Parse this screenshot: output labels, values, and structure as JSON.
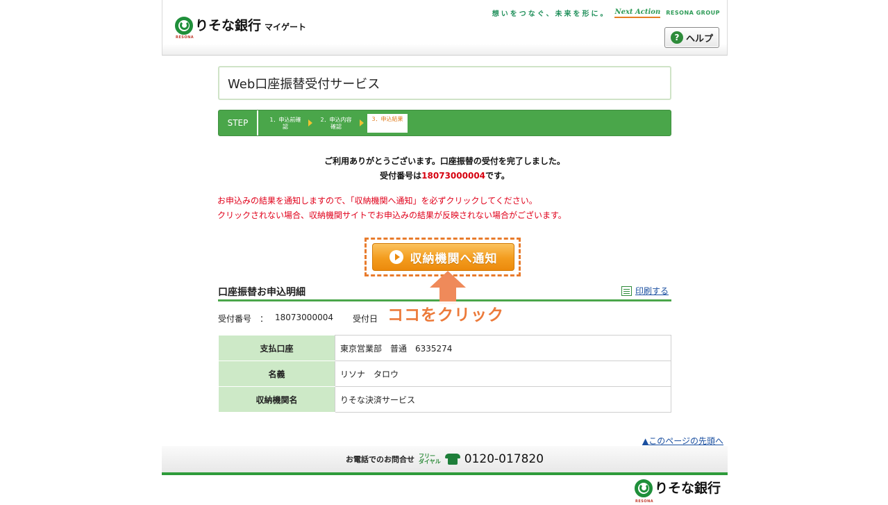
{
  "header": {
    "logo_name": "りそな銀行",
    "logo_sub": "RESONA",
    "app_name": "マイゲート",
    "slogan": "想いをつなぐ、未来を形に。",
    "slogan_brand": "Next Action",
    "group": "RESONA GROUP",
    "help_label": "ヘルプ",
    "help_icon": "question-icon"
  },
  "title": "Web口座振替受付サービス",
  "steps": {
    "label": "STEP",
    "items": [
      {
        "line1": "1．申込前確",
        "line2": "認"
      },
      {
        "line1": "2．申込内容",
        "line2": "確認"
      },
      {
        "line1": "3．申込結果",
        "line2": ""
      }
    ],
    "current": 3
  },
  "message": {
    "line1": "ご利用ありがとうございます。口座振替の受付を完了しました。",
    "line2_prefix": "受付番号は",
    "receipt_number": "18073000004",
    "line2_suffix": "です。"
  },
  "warning": {
    "line1": "お申込みの結果を通知しますので、「収納機関へ通知」を必ずクリックしてください。",
    "line2": "クリックされない場合、収納機関サイトでお申込みの結果が反映されない場合がございます。"
  },
  "notify_button": {
    "label": "収納機関へ通知"
  },
  "callout": "ココをクリック",
  "details": {
    "title": "口座振替お申込明細",
    "print_label": "印刷する",
    "receipt_label": "受付番号",
    "receipt_sep": "：",
    "receipt_value": "18073000004",
    "date_label": "受付日",
    "rows": [
      {
        "label": "支払口座",
        "value": "東京営業部　普通　6335274"
      },
      {
        "label": "名義",
        "value": "リソナ　タロウ"
      },
      {
        "label": "収納機関名",
        "value": "りそな決済サービス"
      }
    ]
  },
  "page_top_link": "▲このページの先頭へ",
  "footer": {
    "contact_label": "お電話でのお問合せ",
    "free_dial_1": "フリー",
    "free_dial_2": "ダイヤル",
    "phone": "0120-017820",
    "logo_name": "りそな銀行",
    "logo_sub": "RESONA"
  },
  "colors": {
    "accent_green": "#4aa64a",
    "button_orange": "#f39c1e",
    "warning_red": "#e0001a",
    "callout_orange": "#ec7a3a"
  }
}
